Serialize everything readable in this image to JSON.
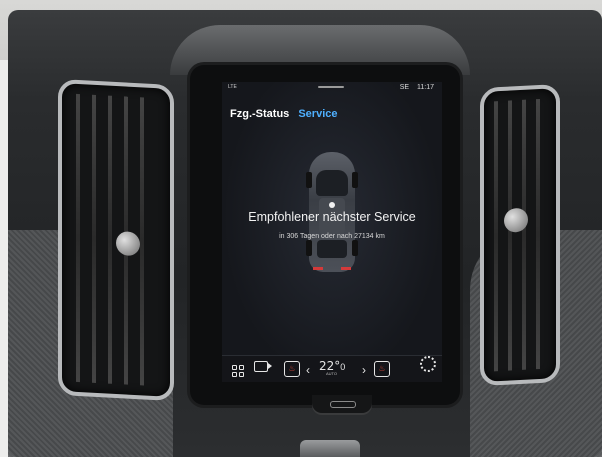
{
  "status_bar": {
    "signal": "LTE",
    "region_label": "SE",
    "time": "11:17"
  },
  "tabs": {
    "vehicle_status": "Fzg.-Status",
    "service": "Service"
  },
  "service": {
    "headline": "Empfohlener nächster Service",
    "detail": "in 306 Tagen oder nach 27134 km"
  },
  "climate_bar": {
    "temperature": "22°",
    "temperature_decimal": "0",
    "mode": "AUTO",
    "icons": [
      "apps-grid-icon",
      "camera-icon",
      "seat-heat-icon",
      "chevron-left-icon",
      "chevron-right-icon",
      "seat-heat-icon",
      "settings-gear-icon"
    ]
  },
  "colors": {
    "accent": "#4fb0ff",
    "heat": "#e54b3b"
  }
}
